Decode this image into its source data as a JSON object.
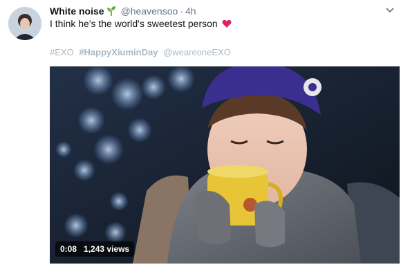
{
  "tweet": {
    "display_name": "White noise",
    "handle": "@heavensoo",
    "separator": "·",
    "time": "4h",
    "text": "I think he's the world's sweetest person",
    "hashtags": [
      "#EXO",
      "#HappyXiuminDay",
      "@weareoneEXO"
    ]
  },
  "media": {
    "duration": "0:08",
    "views": "1,243 views"
  },
  "icons": {
    "sprout": "sprout-icon",
    "heart": "heart-icon",
    "caret": "chevron-down-icon"
  },
  "colors": {
    "heart": "#e0245e",
    "secondary_text": "#657786",
    "hashtag_text": "#aab8c2"
  }
}
